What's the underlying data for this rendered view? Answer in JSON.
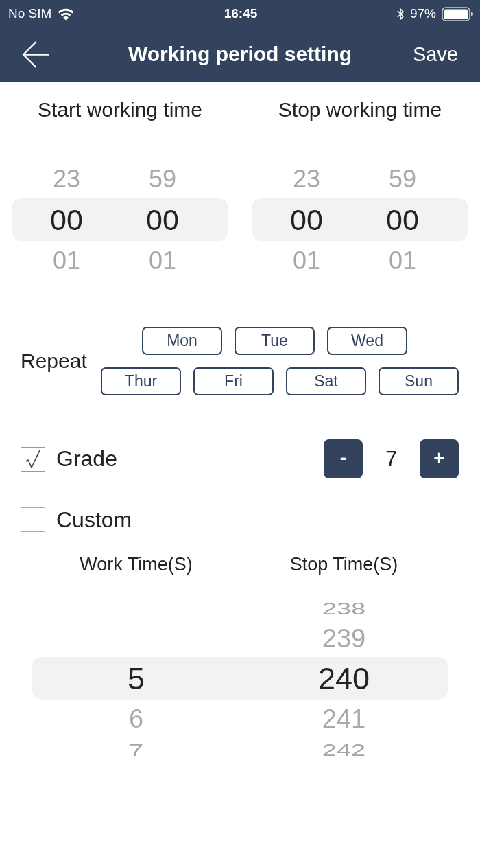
{
  "status_bar": {
    "carrier": "No SIM",
    "time": "16:45",
    "battery": "97%"
  },
  "nav_bar": {
    "title": "Working period setting",
    "action": "Save"
  },
  "time_pickers": [
    {
      "label": "Start working time",
      "columns": [
        {
          "above": [
            "23"
          ],
          "value": "00",
          "below": [
            "01"
          ]
        },
        {
          "above": [
            "59"
          ],
          "value": "00",
          "below": [
            "01"
          ]
        }
      ]
    },
    {
      "label": "Stop working time",
      "columns": [
        {
          "above": [
            "23"
          ],
          "value": "00",
          "below": [
            "01"
          ]
        },
        {
          "above": [
            "59"
          ],
          "value": "00",
          "below": [
            "01"
          ]
        }
      ]
    }
  ],
  "repeat": {
    "label": "Repeat",
    "days": [
      {
        "label": "Mon",
        "selected": false
      },
      {
        "label": "Tue",
        "selected": false
      },
      {
        "label": "Wed",
        "selected": false
      },
      {
        "label": "Thur",
        "selected": false
      },
      {
        "label": "Fri",
        "selected": false
      },
      {
        "label": "Sat",
        "selected": false
      },
      {
        "label": "Sun",
        "selected": false
      }
    ]
  },
  "options": [
    {
      "label": "Grade",
      "checked": true,
      "stepper": {
        "decrement": "-",
        "value": "7",
        "increment": "+"
      }
    },
    {
      "label": "Custom",
      "checked": false
    }
  ],
  "interval_picker": {
    "columns": [
      {
        "label": "Work Time(S)",
        "value": "5",
        "below": [
          "6",
          "7"
        ]
      },
      {
        "label": "Stop Time(S)",
        "above": [
          "238",
          "239"
        ],
        "value": "240",
        "below": [
          "241",
          "242"
        ]
      }
    ]
  }
}
